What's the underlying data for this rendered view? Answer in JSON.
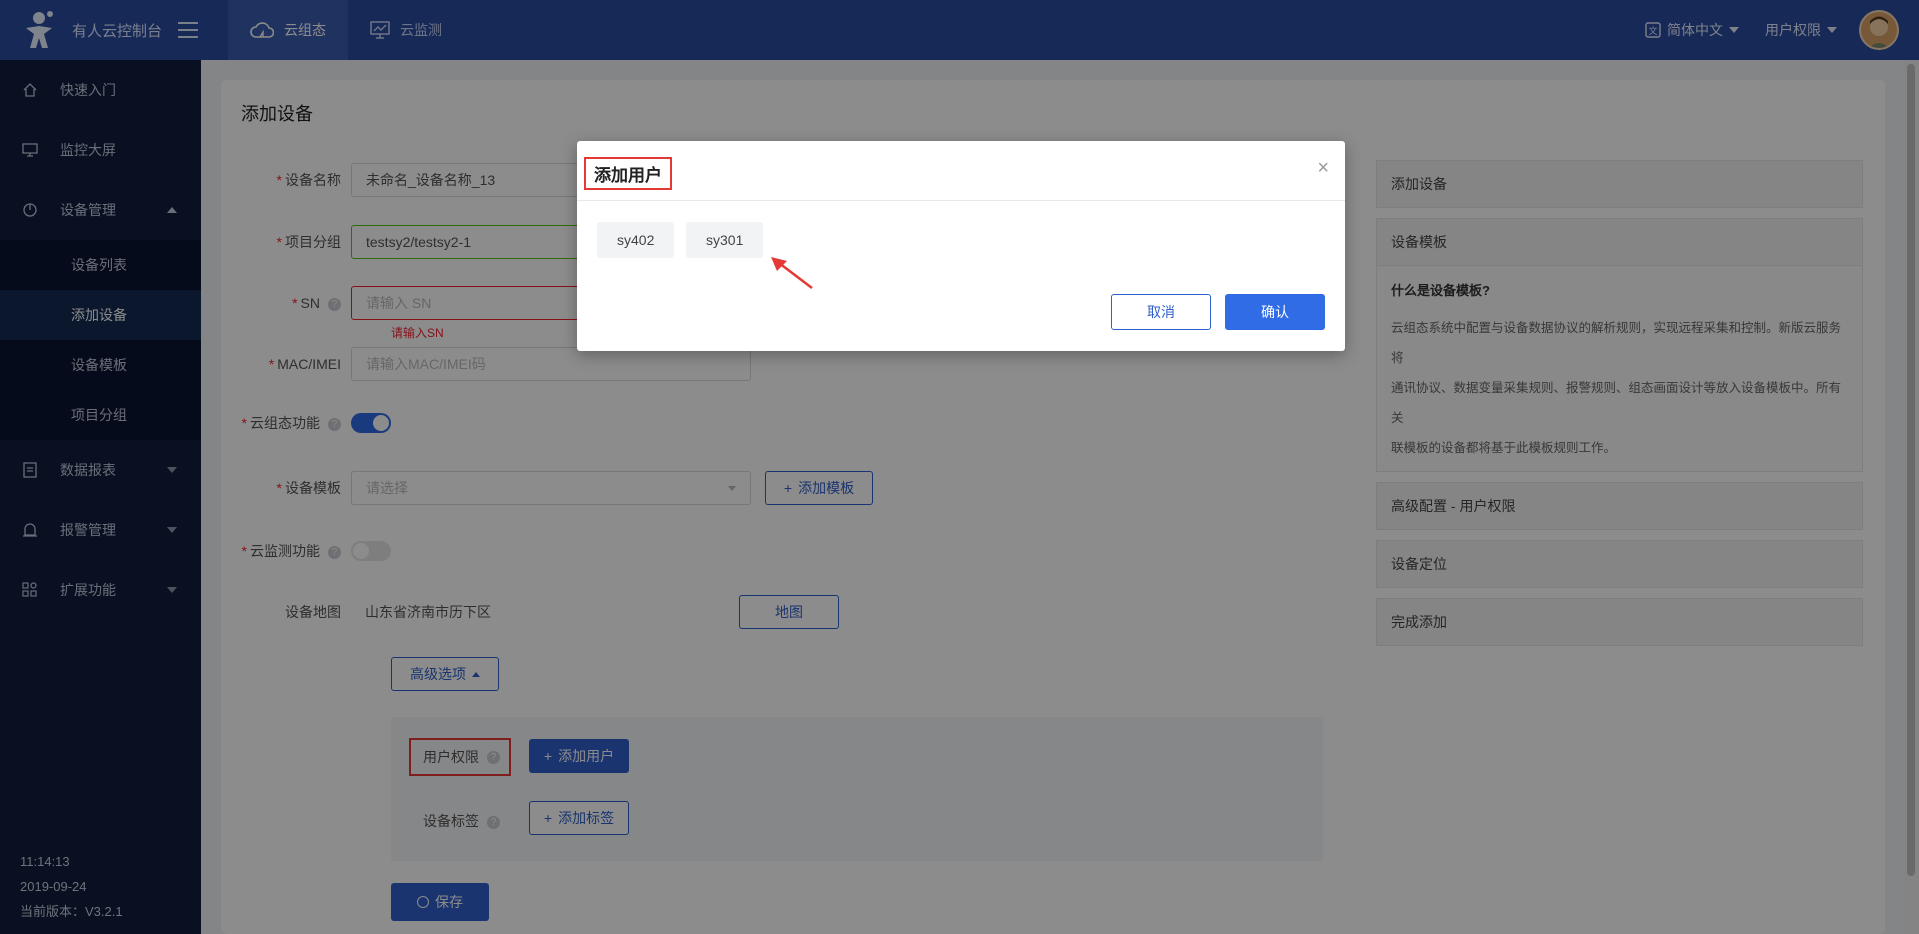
{
  "app": {
    "title": "有人云控制台",
    "tabs": [
      {
        "label": "云组态",
        "active": true
      },
      {
        "label": "云监测",
        "active": false
      }
    ],
    "language": "简体中文",
    "user_menu": "用户权限"
  },
  "sidebar": {
    "items": [
      {
        "label": "快速入门",
        "icon": "home-icon"
      },
      {
        "label": "监控大屏",
        "icon": "monitor-icon"
      },
      {
        "label": "设备管理",
        "icon": "device-icon",
        "expanded": true
      },
      {
        "label": "数据报表",
        "icon": "report-icon"
      },
      {
        "label": "报警管理",
        "icon": "alarm-icon"
      },
      {
        "label": "扩展功能",
        "icon": "extend-icon"
      }
    ],
    "sub_items": [
      "设备列表",
      "添加设备",
      "设备模板",
      "项目分组"
    ],
    "active_sub": "添加设备",
    "footer": {
      "time": "11:14:13",
      "date": "2019-09-24",
      "version": "当前版本：V3.2.1"
    }
  },
  "form": {
    "title": "添加设备",
    "device_name": {
      "label": "设备名称",
      "value": "未命名_设备名称_13"
    },
    "project_group": {
      "label": "项目分组",
      "value": "testsy2/testsy2-1"
    },
    "sn": {
      "label": "SN",
      "placeholder": "请输入 SN",
      "error": "请输入SN"
    },
    "mac": {
      "label": "MAC/IMEI",
      "placeholder": "请输入MAC/IMEI码"
    },
    "cloud_config": {
      "label": "云组态功能",
      "enabled": true
    },
    "template": {
      "label": "设备模板",
      "placeholder": "请选择",
      "add_button": "添加模板"
    },
    "cloud_monitor": {
      "label": "云监测功能",
      "enabled": false
    },
    "map": {
      "label": "设备地图",
      "value": "山东省济南市历下区",
      "button": "地图"
    },
    "advanced_button": "高级选项",
    "user_permission": {
      "label": "用户权限",
      "add_button": "添加用户"
    },
    "device_tag": {
      "label": "设备标签",
      "add_button": "添加标签"
    },
    "save_button": "保存"
  },
  "steps": {
    "items": [
      "添加设备",
      "设备模板",
      "高级配置 - 用户权限",
      "设备定位",
      "完成添加"
    ],
    "detail_title": "什么是设备模板?",
    "detail_lines": [
      "云组态系统中配置与设备数据协议的解析规则，实现远程采集和控制。新版云服务将",
      "通讯协议、数据变量采集规则、报警规则、组态画面设计等放入设备模板中。所有关",
      "联模板的设备都将基于此模板规则工作。"
    ]
  },
  "modal": {
    "title": "添加用户",
    "users": [
      "sy402",
      "sy301"
    ],
    "cancel": "取消",
    "confirm": "确认"
  }
}
